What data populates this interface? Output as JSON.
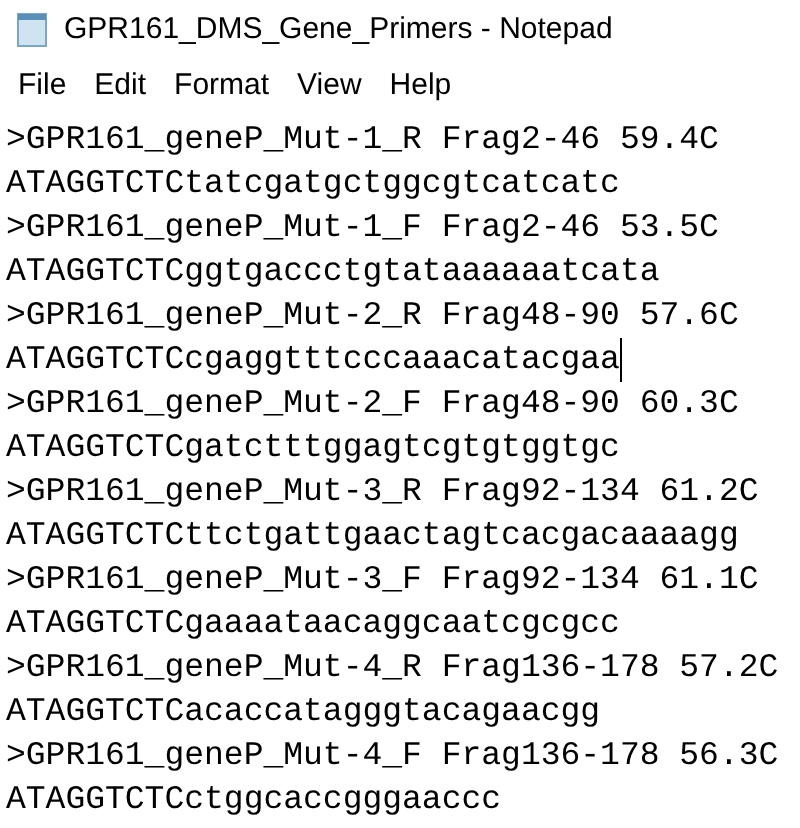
{
  "window": {
    "title": "GPR161_DMS_Gene_Primers - Notepad"
  },
  "menu": [
    "File",
    "Edit",
    "Format",
    "View",
    "Help"
  ],
  "lines": [
    {
      "text": ">GPR161_geneP_Mut-1_R Frag2-46 59.4C",
      "caret": false
    },
    {
      "text": "ATAGGTCTCtatcgatgctggcgtcatcatc",
      "caret": false
    },
    {
      "text": ">GPR161_geneP_Mut-1_F Frag2-46 53.5C",
      "caret": false
    },
    {
      "text": "ATAGGTCTCggtgaccctgtataaaaaatcata",
      "caret": false
    },
    {
      "text": ">GPR161_geneP_Mut-2_R Frag48-90 57.6C",
      "caret": false
    },
    {
      "text": "ATAGGTCTCcgaggtttcccaaacatacgaa",
      "caret": true
    },
    {
      "text": ">GPR161_geneP_Mut-2_F Frag48-90 60.3C",
      "caret": false
    },
    {
      "text": "ATAGGTCTCgatctttggagtcgtgtggtgc",
      "caret": false
    },
    {
      "text": ">GPR161_geneP_Mut-3_R Frag92-134 61.2C",
      "caret": false
    },
    {
      "text": "ATAGGTCTCttctgattgaactagtcacgacaaaagg",
      "caret": false
    },
    {
      "text": ">GPR161_geneP_Mut-3_F Frag92-134 61.1C",
      "caret": false
    },
    {
      "text": "ATAGGTCTCgaaaataacaggcaatcgcgcc",
      "caret": false
    },
    {
      "text": ">GPR161_geneP_Mut-4_R Frag136-178 57.2C",
      "caret": false
    },
    {
      "text": "ATAGGTCTCacaccatagggtacagaacgg",
      "caret": false
    },
    {
      "text": ">GPR161_geneP_Mut-4_F Frag136-178 56.3C",
      "caret": false
    },
    {
      "text": "ATAGGTCTCctggcaccgggaaccc",
      "caret": false
    }
  ]
}
